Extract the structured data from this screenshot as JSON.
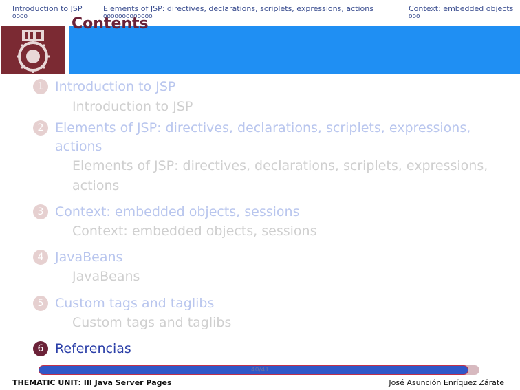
{
  "nav": {
    "sections": [
      {
        "title": "Introduction to JSP",
        "dots": "oooo"
      },
      {
        "title": "Elements of JSP: directives, declarations, scriplets, expressions, actions",
        "dots": "ooooooooooooo"
      },
      {
        "title": "Context: embedded objects",
        "dots": "ooo"
      }
    ]
  },
  "header": {
    "title": "Contents"
  },
  "toc": [
    {
      "number": "1",
      "title": "Introduction to JSP",
      "sub": [
        "Introduction to JSP"
      ]
    },
    {
      "number": "2",
      "title": [
        "Elements of JSP: directives, declarations, scriplets, expressions,",
        "actions"
      ],
      "sub": [
        "Elements of JSP: directives, declarations, scriplets, expressions,",
        "actions"
      ]
    },
    {
      "number": "3",
      "title": "Context: embedded objects, sessions",
      "sub": [
        "Context: embedded objects, sessions"
      ]
    },
    {
      "number": "4",
      "title": "JavaBeans",
      "sub": [
        "JavaBeans"
      ]
    },
    {
      "number": "5",
      "title": "Custom tags and taglibs",
      "sub": [
        "Custom tags and taglibs"
      ]
    },
    {
      "number": "6",
      "title": "Referencias",
      "sub": []
    }
  ],
  "progress": {
    "current": 40,
    "total": 41,
    "label": "40/41"
  },
  "footer": {
    "left": "THEMATIC UNIT: III Java Server Pages",
    "right": "José Asunción Enríquez Zárate"
  },
  "colors": {
    "accent_blue": "#1f8ff3",
    "maroon": "#6b2238"
  }
}
